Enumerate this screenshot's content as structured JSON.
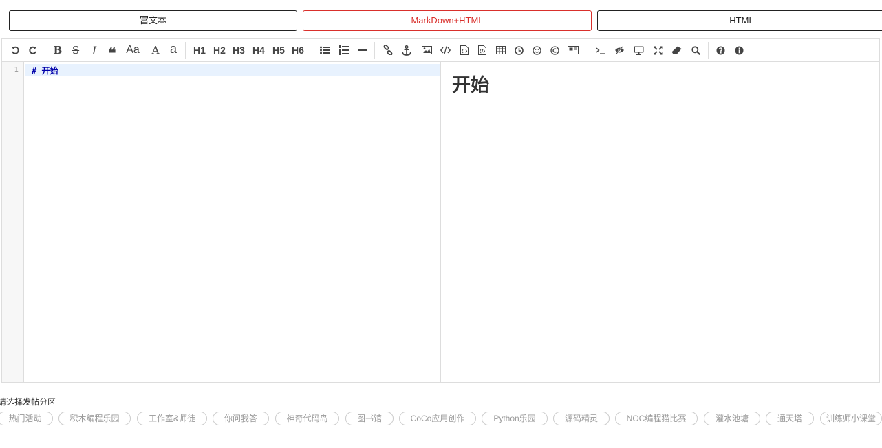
{
  "mode_tabs": {
    "rich_text": "富文本",
    "markdown_html": "MarkDown+HTML",
    "html": "HTML",
    "active_color": "#d9302c"
  },
  "toolbar": {
    "headings": [
      "H1",
      "H2",
      "H3",
      "H4",
      "H5",
      "H6"
    ],
    "uppercase_lowercase_label": "Aa",
    "uppercase_label": "A",
    "lowercase_label": "a",
    "icons": [
      "undo-icon",
      "redo-icon",
      "bold-icon",
      "strikethrough-icon",
      "italic-icon",
      "quote-icon",
      "uppercase-lowercase-icon",
      "uppercase-icon",
      "lowercase-icon",
      "unordered-list-icon",
      "ordered-list-icon",
      "horizontal-rule-icon",
      "link-icon",
      "anchor-icon",
      "image-icon",
      "code-icon",
      "preformatted-code-icon",
      "code-block-icon",
      "table-icon",
      "datetime-icon",
      "emoji-icon",
      "html-entities-icon",
      "pagebreak-icon",
      "terminal-icon",
      "watch-toggle-icon",
      "preview-icon",
      "fullscreen-icon",
      "clear-icon",
      "search-icon",
      "help-icon",
      "info-icon"
    ]
  },
  "editor": {
    "line_number": "1",
    "source_line": "# 开始",
    "preview_heading": "开始"
  },
  "section": {
    "label": "请选择发帖分区",
    "chips": [
      "热门活动",
      "积木编程乐园",
      "工作室&师徒",
      "你问我答",
      "神奇代码岛",
      "图书馆",
      "CoCo应用创作",
      "Python乐园",
      "源码精灵",
      "NOC编程猫比赛",
      "灌水池塘",
      "通天塔",
      "训练师小课堂"
    ]
  }
}
